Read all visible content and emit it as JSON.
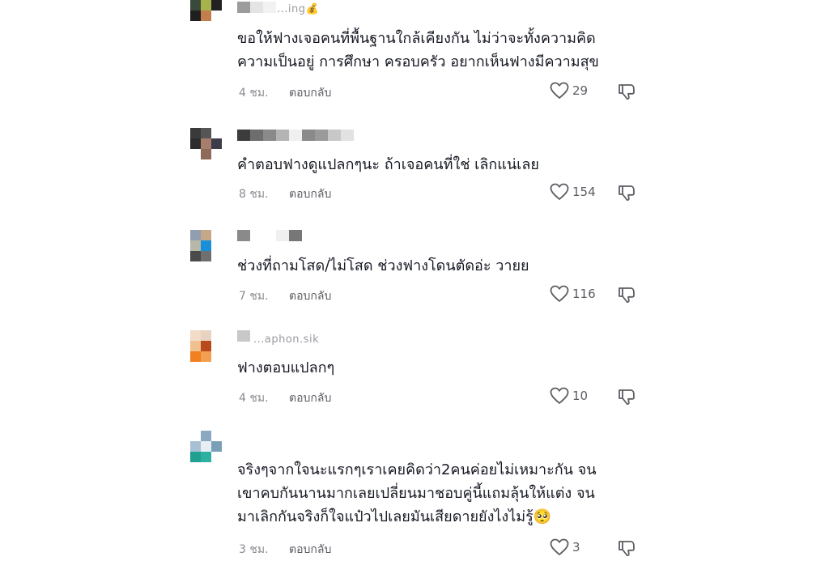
{
  "comments": [
    {
      "username": "...ing",
      "username_badge": "💰",
      "lines": [
        "ขอให้ฟางเจอคนที่พื้นฐานใกล้เคียงกัน ไม่ว่าจะทั้งความคิด",
        "ความเป็นอยู่ การศึกษา ครอบครัว อยากเห็นฟางมีความสุข"
      ],
      "time": "4 ชม.",
      "reply": "ตอบกลับ",
      "likes": "29"
    },
    {
      "username": "",
      "lines": [
        "คำตอบฟางดูแปลกๆนะ ถ้าเจอคนที่ใช่ เลิกแน่เลย"
      ],
      "time": "8 ชม.",
      "reply": "ตอบกลับ",
      "likes": "154"
    },
    {
      "username": "",
      "lines": [
        "ช่วงที่ถามโสด/ไม่โสด ช่วงฟางโดนตัดอ่ะ วายย"
      ],
      "time": "7 ชม.",
      "reply": "ตอบกลับ",
      "likes": "116"
    },
    {
      "username": "...aphon.sik",
      "lines": [
        "ฟางตอบแปลกๆ"
      ],
      "time": "4 ชม.",
      "reply": "ตอบกลับ",
      "likes": "10"
    },
    {
      "username": "",
      "lines": [
        "จริงๆจากใจนะแรกๆเราเคยคิดว่า2คนค่อยไม่เหมาะกัน จน",
        "เขาคบกันนานมากเลยเปลี่ยนมาชอบคู่นี้แถมลุ้นให้แต่ง จน",
        "มาเลิกกันจริงก็ใจแป๋วไปเลยมันเสียดายยังไงไม่รู้🥺"
      ],
      "time": "3 ชม.",
      "reply": "ตอบกลับ",
      "likes": "3"
    }
  ],
  "icons": {
    "like": "heart-outline-icon",
    "dislike": "thumbs-down-outline-icon"
  },
  "colors": {
    "text": "#161823",
    "muted": "#8a8b91",
    "reply": "#5c5d63",
    "background": "#ffffff"
  }
}
